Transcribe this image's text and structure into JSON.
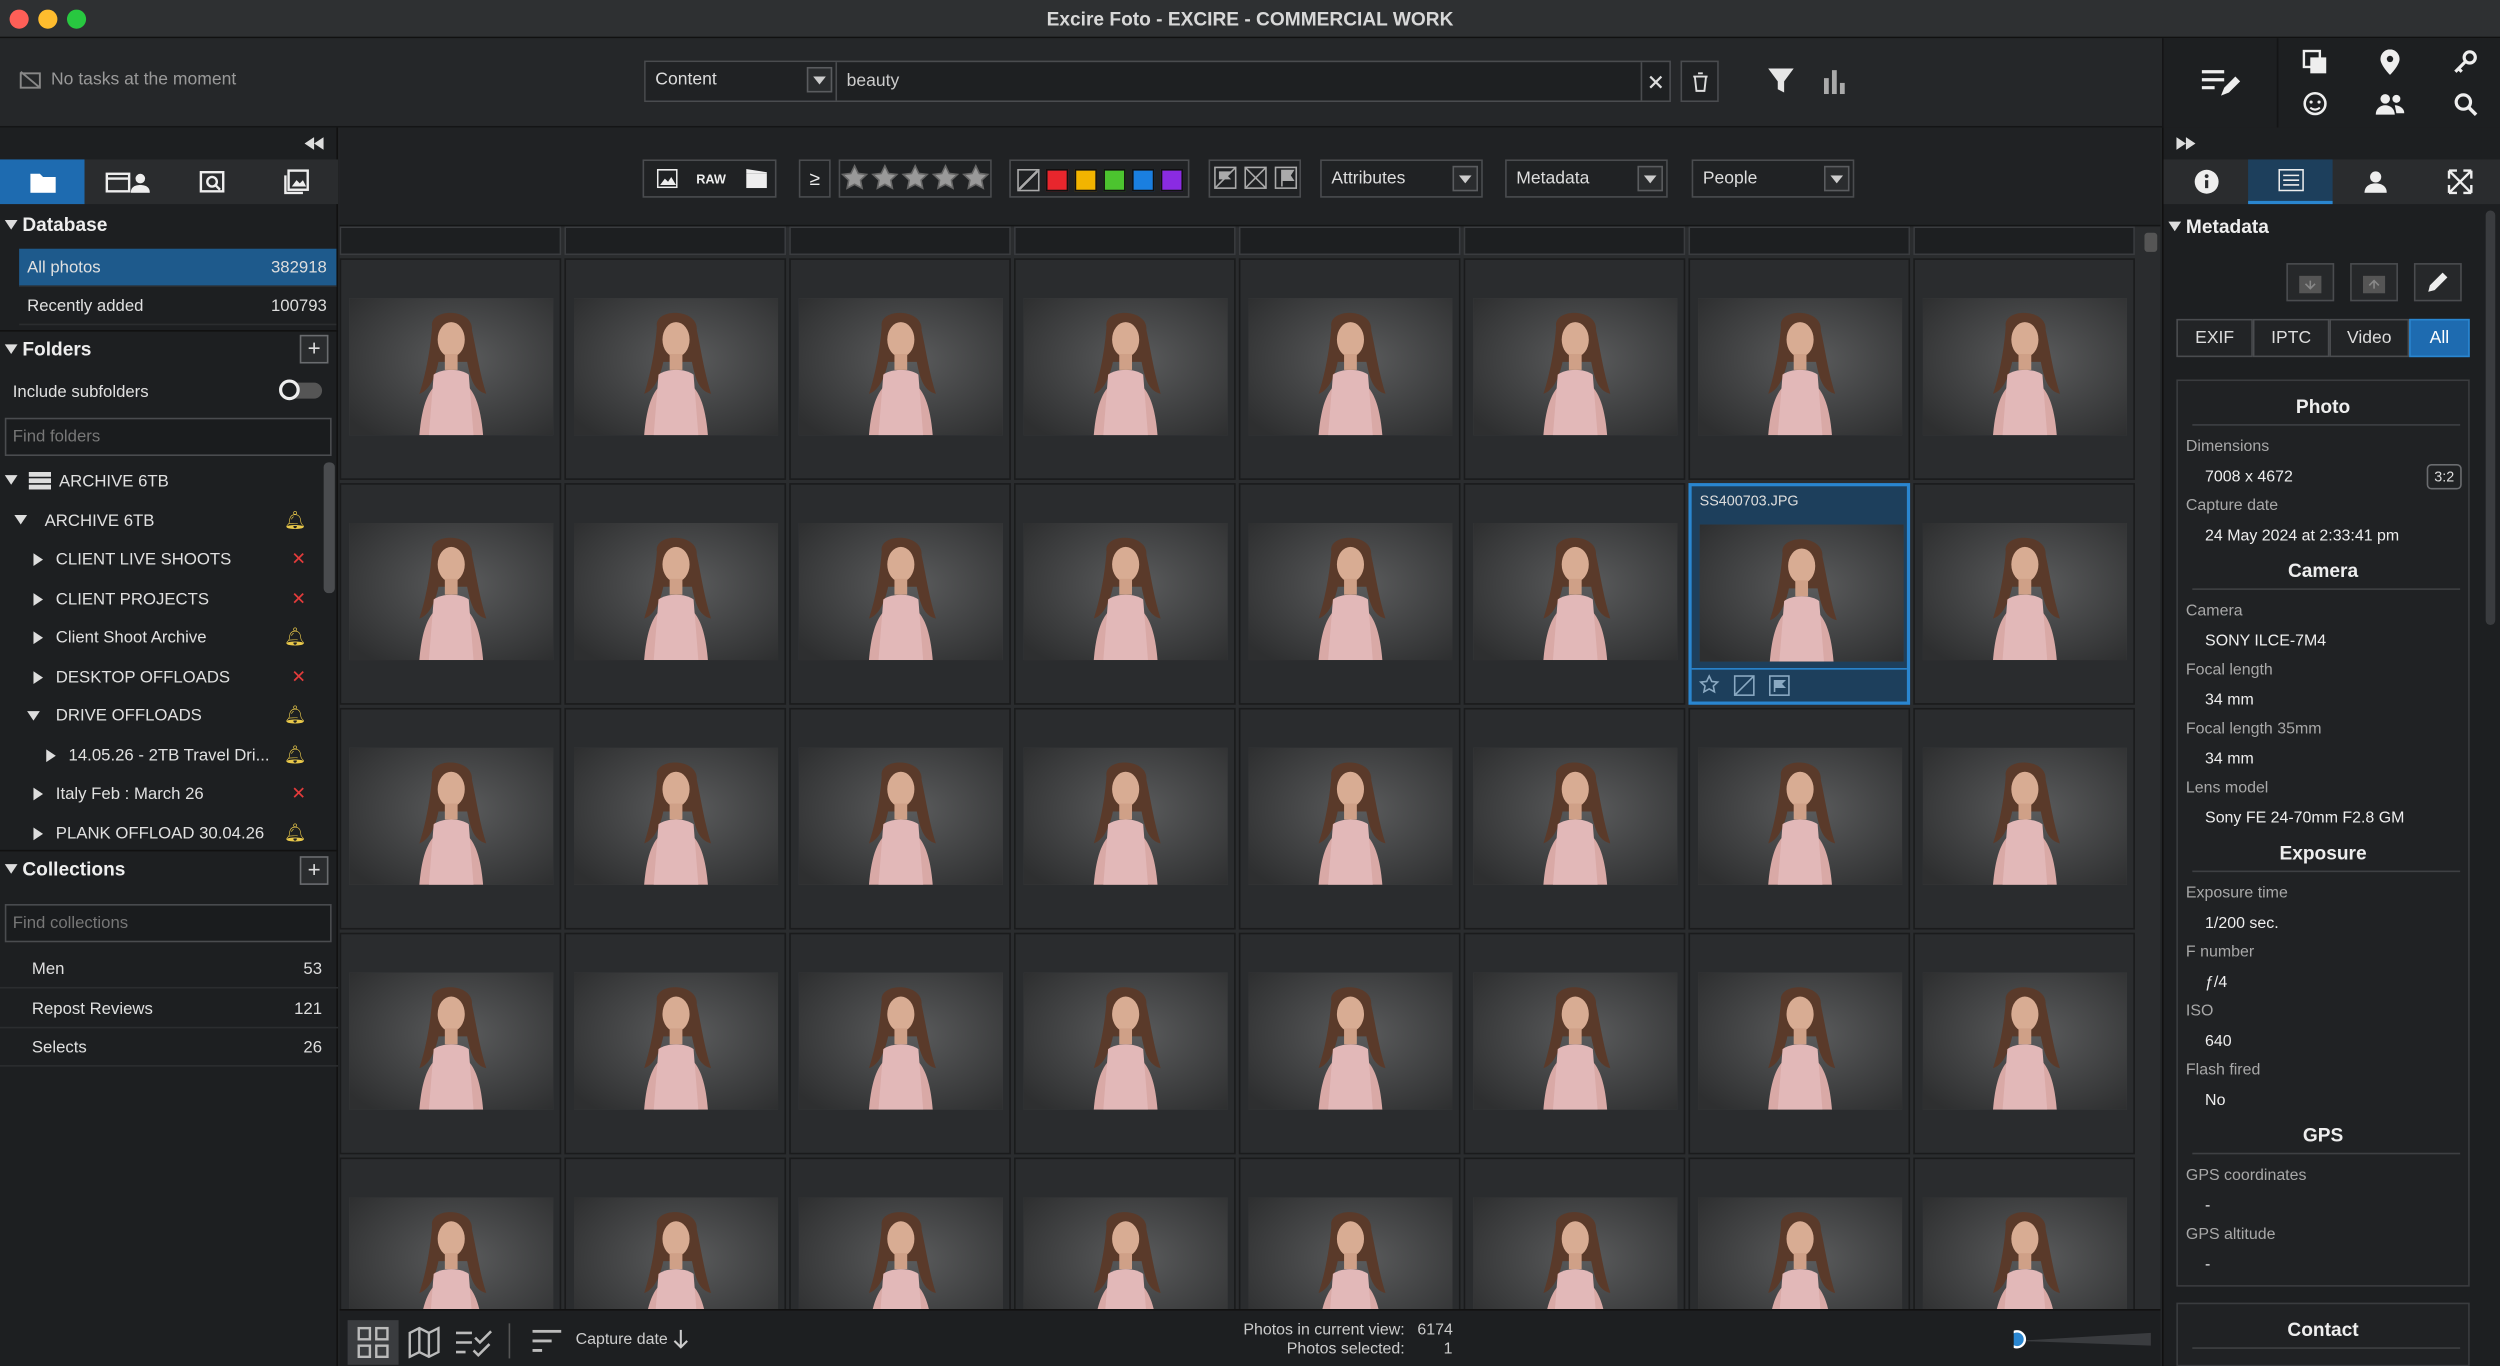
{
  "window": {
    "title": "Excire Foto - EXCIRE - COMMERCIAL WORK"
  },
  "topbar": {
    "tasks_text": "No tasks at the moment",
    "search_mode": "Content",
    "search_query": "beauty"
  },
  "sidebar": {
    "database": {
      "title": "Database",
      "items": [
        {
          "label": "All photos",
          "count": "382918"
        },
        {
          "label": "Recently added",
          "count": "100793"
        }
      ]
    },
    "folders": {
      "title": "Folders",
      "include_subfolders": "Include subfolders",
      "find_placeholder": "Find folders",
      "drive": "ARCHIVE 6TB",
      "root": "ARCHIVE 6TB",
      "items": [
        {
          "label": "CLIENT LIVE SHOOTS"
        },
        {
          "label": "CLIENT PROJECTS"
        },
        {
          "label": "Client Shoot Archive"
        },
        {
          "label": "DESKTOP OFFLOADS"
        },
        {
          "label": "DRIVE OFFLOADS"
        },
        {
          "label": "14.05.26 - 2TB Travel Dri..."
        },
        {
          "label": "Italy Feb : March 26"
        },
        {
          "label": "PLANK OFFLOAD 30.04.26"
        }
      ]
    },
    "collections": {
      "title": "Collections",
      "find_placeholder": "Find collections",
      "items": [
        {
          "label": "Men",
          "count": "53"
        },
        {
          "label": "Repost Reviews",
          "count": "121"
        },
        {
          "label": "Selects",
          "count": "26"
        }
      ]
    }
  },
  "filters": {
    "raw_label": "RAW",
    "gte_label": "≥",
    "attributes": "Attributes",
    "metadata": "Metadata",
    "people": "People",
    "color_labels": [
      "#e8262d",
      "#f2b400",
      "#4cc42f",
      "#1a7fe0",
      "#8a2be2"
    ]
  },
  "grid": {
    "selected_file": "SS400703.JPG"
  },
  "statusbar": {
    "sort_label": "Capture date",
    "photos_in_view_label": "Photos in current view:",
    "photos_in_view": "6174",
    "photos_selected_label": "Photos selected:",
    "photos_selected": "1"
  },
  "metadata_panel": {
    "title": "Metadata",
    "tabs": [
      "EXIF",
      "IPTC",
      "Video",
      "All"
    ],
    "active_tab": "All",
    "photo": {
      "heading": "Photo",
      "dimensions_label": "Dimensions",
      "dimensions": "7008 x 4672",
      "ratio": "3:2",
      "capture_date_label": "Capture date",
      "capture_date": "24 May 2024 at 2:33:41 pm"
    },
    "camera": {
      "heading": "Camera",
      "camera_label": "Camera",
      "camera": "SONY ILCE-7M4",
      "focal_length_label": "Focal length",
      "focal_length": "34 mm",
      "focal_length_35_label": "Focal length 35mm",
      "focal_length_35": "34 mm",
      "lens_label": "Lens model",
      "lens": "Sony FE 24-70mm F2.8 GM"
    },
    "exposure": {
      "heading": "Exposure",
      "time_label": "Exposure time",
      "time": "1/200 sec.",
      "fnumber_label": "F number",
      "fnumber": "ƒ/4",
      "iso_label": "ISO",
      "iso": "640",
      "flash_label": "Flash fired",
      "flash": "No"
    },
    "gps": {
      "heading": "GPS",
      "coords_label": "GPS coordinates",
      "coords": "-",
      "alt_label": "GPS altitude",
      "alt": "-"
    },
    "contact": {
      "heading": "Contact"
    }
  }
}
